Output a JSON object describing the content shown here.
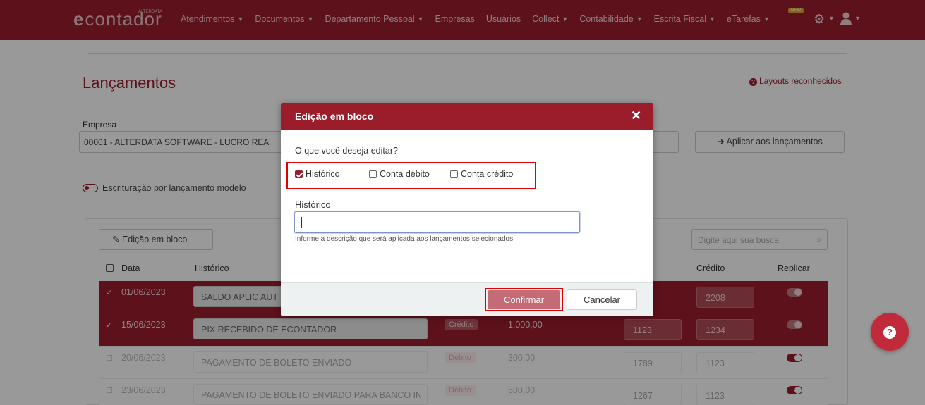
{
  "brand": {
    "name": "contador",
    "prefix": "e",
    "tag": "ALTERDATA"
  },
  "nav": {
    "items": [
      {
        "label": "Atendimentos",
        "dropdown": true
      },
      {
        "label": "Documentos",
        "dropdown": true
      },
      {
        "label": "Departamento Pessoal",
        "dropdown": true
      },
      {
        "label": "Empresas",
        "dropdown": false
      },
      {
        "label": "Usuários",
        "dropdown": false
      },
      {
        "label": "Collect",
        "dropdown": true
      },
      {
        "label": "Contabilidade",
        "dropdown": true
      },
      {
        "label": "Escrita Fiscal",
        "dropdown": true
      },
      {
        "label": "eTarefas",
        "dropdown": true
      }
    ],
    "new_badge": "NEW"
  },
  "page": {
    "title": "Lançamentos",
    "layouts_link": "Layouts reconhecidos",
    "empresa_label": "Empresa",
    "empresa_value": "00001 - ALTERDATA SOFTWARE - LUCRO REA",
    "aplicar_label": "Aplicar aos lançamentos",
    "escrituracao_label": "Escrituração por lançamento modelo",
    "bloco_label": "Edição em bloco",
    "search_placeholder": "Digite aqui sua busca",
    "columns": {
      "data": "Data",
      "historico": "Histórico",
      "credito": "Crédito",
      "replicar": "Replicar"
    },
    "rows": [
      {
        "selected": true,
        "date": "01/06/2023",
        "historico": "SALDO APLIC AUT",
        "tipo": "",
        "valor": "",
        "debito": "",
        "credito": "2208"
      },
      {
        "selected": true,
        "date": "15/06/2023",
        "historico": "PIX RECEBIDO DE ECONTADOR",
        "tipo": "Crédito",
        "valor": "1.000,00",
        "debito": "1123",
        "credito": "1234"
      },
      {
        "selected": false,
        "date": "20/06/2023",
        "historico": "PAGAMENTO DE BOLETO ENVIADO",
        "tipo": "Débito",
        "valor": "300,00",
        "debito": "1789",
        "credito": "1123"
      },
      {
        "selected": false,
        "date": "23/06/2023",
        "historico": "PAGAMENTO DE BOLETO ENVIADO PARA BANCO IN",
        "tipo": "Débito",
        "valor": "500,00",
        "debito": "1267",
        "credito": "1123"
      }
    ]
  },
  "modal": {
    "title": "Edição em bloco",
    "question": "O que você deseja editar?",
    "options": [
      {
        "label": "Histórico",
        "checked": true
      },
      {
        "label": "Conta débito",
        "checked": false
      },
      {
        "label": "Conta crédito",
        "checked": false
      }
    ],
    "field_label": "Histórico",
    "field_value": "",
    "field_help": "Informe a descrição que será aplicada aos lançamentos selecionados.",
    "confirm_label": "Confirmar",
    "cancel_label": "Cancelar"
  },
  "colors": {
    "brand": "#9b1d2c",
    "highlight": "#e00000"
  }
}
